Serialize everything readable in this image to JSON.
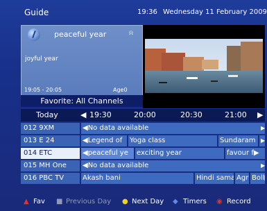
{
  "header": {
    "title": "Guide",
    "time": "19:36",
    "date": "Wednesday 11 February 2009"
  },
  "info": {
    "program_name": "peaceful year",
    "subtitle": "joyful year",
    "time_range": "19:05 - 20:05",
    "age": "Age0",
    "signal_icon": "signal-icon"
  },
  "favorite_label": "Favorite: All Channels",
  "timebar": {
    "day": "Today",
    "left_arrow": "◀",
    "slots": [
      "19:30",
      "20:00",
      "20:30",
      "21:00"
    ],
    "right_arrow": "▶"
  },
  "channels": [
    {
      "name": "012 9XM",
      "programs": [
        {
          "label": "◀No data available"
        },
        {
          "label": "▶"
        }
      ]
    },
    {
      "name": "013 E 24",
      "programs": [
        {
          "label": "◀Legend of"
        },
        {
          "label": "Yoga class"
        },
        {
          "label": "Sundaram"
        },
        {
          "label": "▶"
        }
      ]
    },
    {
      "name": "014 ETC",
      "selected": true,
      "programs": [
        {
          "label": "◀peaceful ye"
        },
        {
          "label": "exciting year"
        },
        {
          "label": "favour f▶"
        }
      ]
    },
    {
      "name": "015 MH One",
      "programs": [
        {
          "label": "◀No data available"
        },
        {
          "label": "▶"
        }
      ]
    },
    {
      "name": "016 PBC TV",
      "programs": [
        {
          "label": "Akash bani"
        },
        {
          "label": "Hindi sama"
        },
        {
          "label": "Agri"
        },
        {
          "label": "Boll▶"
        }
      ]
    }
  ],
  "legend": {
    "fav": "Fav",
    "previous_day": "Previous Day",
    "next_day": "Next Day",
    "timers": "Timers",
    "record": "Record"
  },
  "colors": {
    "red": "#e83030",
    "gray": "#8f9ab8",
    "yellow": "#f2d21b",
    "blue": "#5f89e6",
    "record": "#e83030"
  }
}
